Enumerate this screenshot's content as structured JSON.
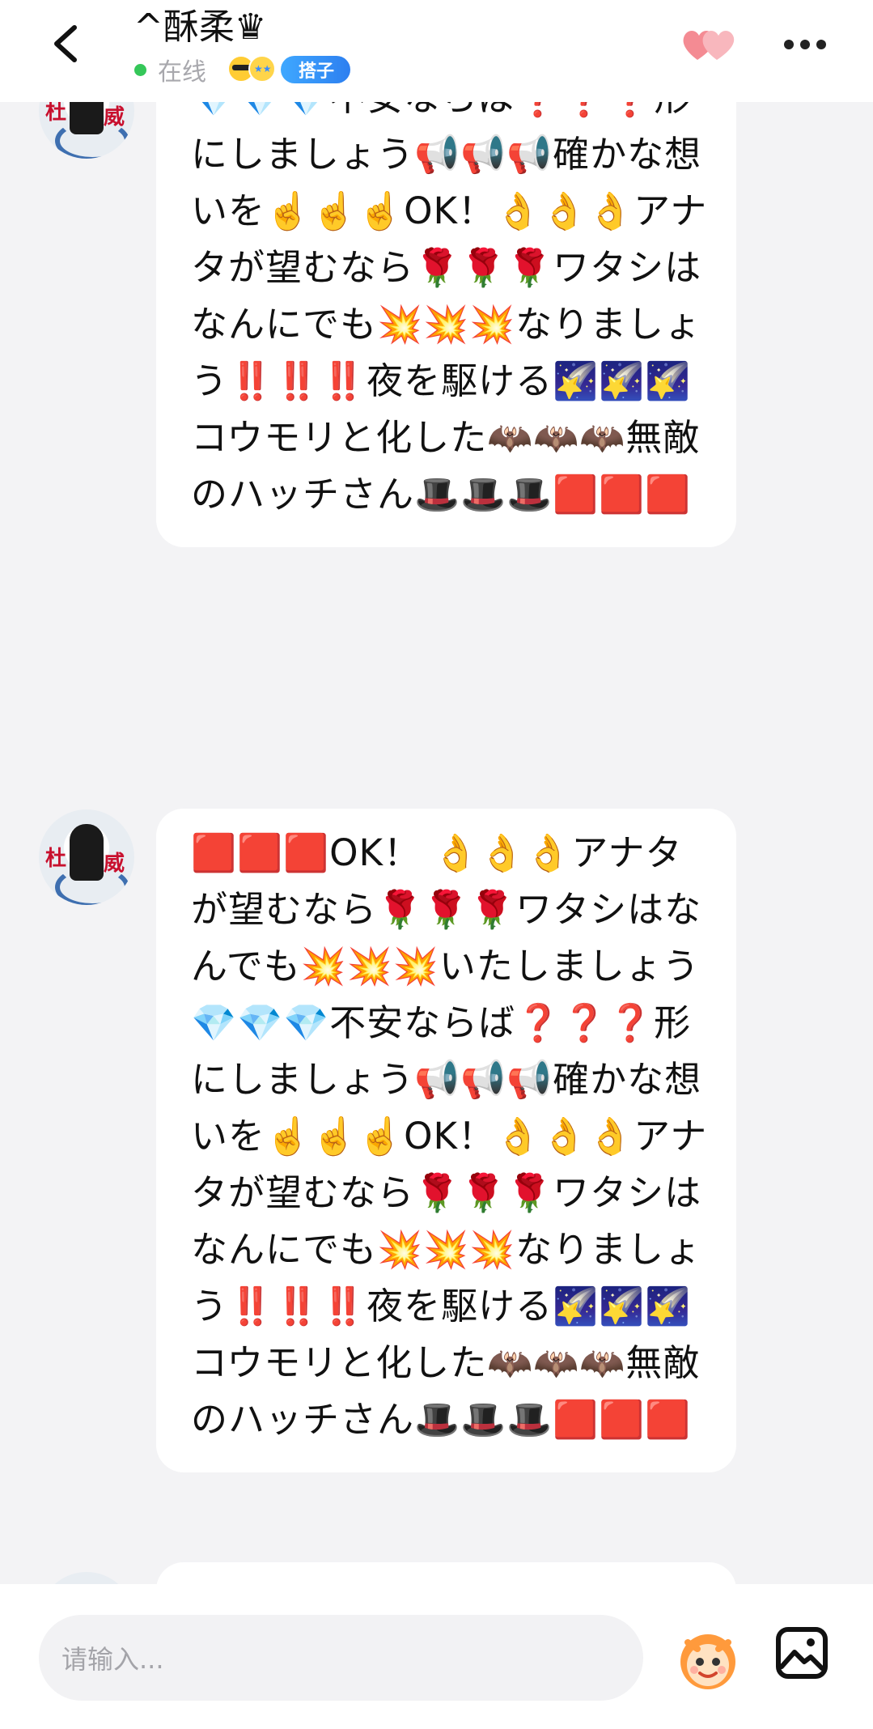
{
  "header": {
    "title": "^酥柔♛",
    "status_text": "在线",
    "badge_label": "搭子"
  },
  "messages": [
    {
      "text": "🟥🟥🟥OK！ 👌👌👌アナタが望むなら🌹🌹🌹ワタシはなんでも💥💥💥いたしましょう💎💎💎不安ならば❓❓❓形にしましょう📢📢📢確かな想いを☝️☝️☝️OK！👌👌👌アナタが望むなら🌹🌹🌹ワタシはなんにでも💥💥💥なりましょう‼️‼️‼️夜を駆ける🌠🌠🌠コウモリと化した🦇🦇🦇無敵のハッチさん🎩🎩🎩🟥🟥🟥"
    },
    {
      "text": "🟥🟥🟥OK！ 👌👌👌アナタが望むなら🌹🌹🌹ワタシはなんでも💥💥💥いたしましょう💎💎💎不安ならば❓❓❓形にしましょう📢📢📢確かな想いを☝️☝️☝️OK！👌👌👌アナタが望むなら🌹🌹🌹ワタシはなんにでも💥💥💥なりましょう‼️‼️‼️夜を駆ける🌠🌠🌠コウモリと化した🦇🦇🦇無敵のハッチさん🎩🎩🎩🟥🟥🟥"
    }
  ],
  "input": {
    "placeholder": "请输入..."
  },
  "colors": {
    "online": "#35c759",
    "badge": "#2d7ff0",
    "background": "#f3f3f5"
  },
  "icons": [
    "back-arrow-icon",
    "hearts-icon",
    "more-icon",
    "sticker-icon",
    "image-icon"
  ]
}
